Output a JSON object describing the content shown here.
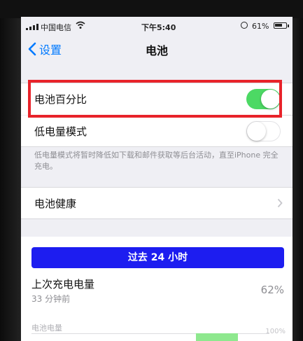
{
  "status_bar": {
    "carrier": "中国电信",
    "time": "下午5:40",
    "battery_percent": "61%",
    "battery_level": 0.61
  },
  "nav": {
    "back_label": "设置",
    "title": "电池"
  },
  "settings": {
    "battery_percentage": {
      "label": "电池百分比",
      "enabled": true
    },
    "low_power_mode": {
      "label": "低电量模式",
      "enabled": false
    },
    "low_power_footnote": "低电量模式将暂时降低如下载和邮件获取等后台活动，直至iPhone 完全充电。",
    "battery_health": {
      "label": "电池健康"
    }
  },
  "usage": {
    "range_tab": "过去 24 小时",
    "last_charge_label": "上次充电电量",
    "last_charge_time": "33 分钟前",
    "last_charge_value": "62%",
    "battery_level_label": "电池电量",
    "axis_top": "100%"
  },
  "colors": {
    "accent": "#007aff",
    "toggle_on": "#4cd964",
    "tab_bar": "#1d1df0",
    "highlight": "#e8232a"
  }
}
